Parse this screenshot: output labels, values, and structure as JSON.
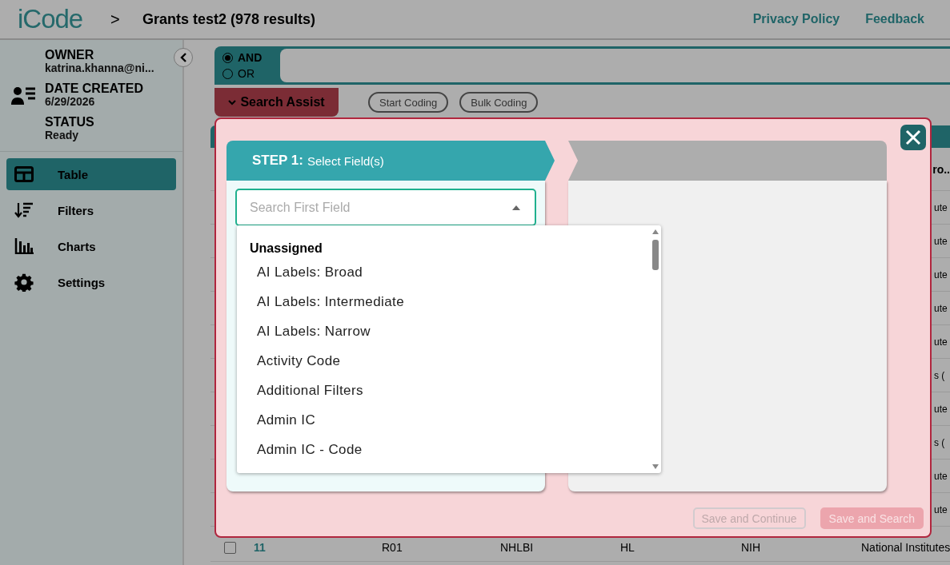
{
  "header": {
    "logo": "iCode",
    "separator": ">",
    "title": "Grants test2 (978 results)",
    "links": [
      "Privacy Policy",
      "Feedback"
    ]
  },
  "sidebar": {
    "details": [
      {
        "label": "OWNER",
        "value": "katrina.khanna@ni..."
      },
      {
        "label": "DATE CREATED",
        "value": "6/29/2026"
      },
      {
        "label": "STATUS",
        "value": "Ready"
      }
    ],
    "nav": [
      {
        "label": "Table",
        "selected": true
      },
      {
        "label": "Filters",
        "selected": false
      },
      {
        "label": "Charts",
        "selected": false
      },
      {
        "label": "Settings",
        "selected": false
      }
    ]
  },
  "query": {
    "operators": [
      {
        "label": "AND",
        "selected": true
      },
      {
        "label": "OR",
        "selected": false
      }
    ]
  },
  "toolbar": {
    "search_assist": "Search Assist",
    "buttons": [
      "Start Coding",
      "Bulk Coding"
    ]
  },
  "table": {
    "header_fragment": "ro..",
    "row_fragments": [
      "ute",
      "ute",
      "ute",
      "ute",
      "ute",
      "s (",
      "ute",
      "s (",
      "ute",
      "ute"
    ],
    "last_row": {
      "checked": false,
      "cells": [
        "11",
        "R01",
        "NHLBI",
        "HL",
        "NIH",
        "National Institutes"
      ]
    }
  },
  "modal": {
    "steps": [
      {
        "label": "STEP 1:",
        "title": "Select Field(s)",
        "selected": true
      },
      {
        "selected": false
      }
    ],
    "field": {
      "placeholder": "Search First Field",
      "expanded": true
    },
    "dropdown": {
      "group": "Unassigned",
      "options": [
        "AI Labels: Broad",
        "AI Labels: Intermediate",
        "AI Labels: Narrow",
        "Activity Code",
        "Additional Filters",
        "Admin IC",
        "Admin IC - Code"
      ]
    },
    "buttons": [
      {
        "label": "Save and Continue",
        "kind": "outline",
        "disabled": true
      },
      {
        "label": "Save and Search",
        "kind": "filled",
        "disabled": true
      }
    ]
  }
}
